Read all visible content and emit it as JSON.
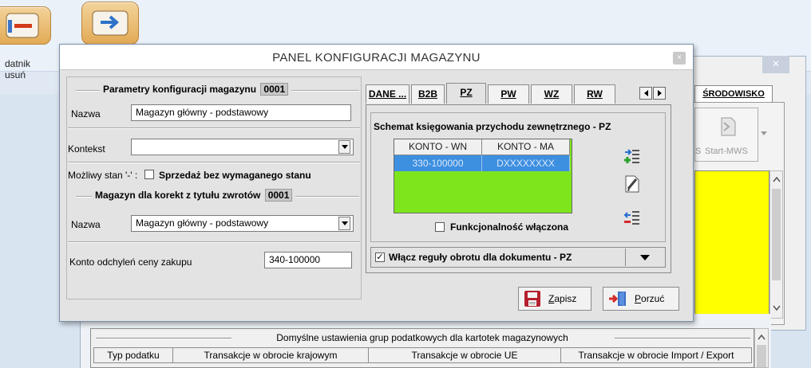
{
  "background": {
    "left_labels": [
      "datnik",
      "usuń"
    ],
    "srodowisko_tab": "ŚRODOWISKO",
    "start_mws": "Start-MWS",
    "start_prefix": "S",
    "close_glyph": "×",
    "bottom_grid": {
      "title": "Domyślne ustawienia grup podatkowych dla kartotek magazynowych",
      "columns": [
        "Typ podatku",
        "Transakcje w obrocie krajowym",
        "Transakcje w obrocie UE",
        "Transakcje w obrocie Import / Export"
      ]
    }
  },
  "dialog": {
    "title": "PANEL KONFIGURACJI MAGAZYNU",
    "close_glyph": "×",
    "params": {
      "legend": "Parametry konfiguracji magazynu",
      "code": "0001",
      "nazwa_label": "Nazwa",
      "nazwa_value": "Magazyn główny - podstawowy",
      "kontekst_label": "Kontekst",
      "kontekst_value": "",
      "mozliwy_stan_label": "Możliwy stan '-' :",
      "sprzedaz_label": "Sprzedaż bez wymaganego stanu"
    },
    "korekty": {
      "legend": "Magazyn dla korekt z tytułu zwrotów",
      "code": "0001",
      "nazwa_label": "Nazwa",
      "nazwa_value": "Magazyn główny - podstawowy"
    },
    "konto": {
      "label": "Konto odchyleń ceny zakupu",
      "value": "340-100000"
    },
    "tabs": [
      "DANE ...",
      "B2B",
      "PZ",
      "PW",
      "WZ",
      "RW"
    ],
    "active_tab": "PZ",
    "pz": {
      "schema_title": "Schemat księgowania przychodu zewnętrznego - PZ",
      "columns": [
        "KONTO - WN",
        "KONTO - MA"
      ],
      "rows": [
        [
          "330-100000",
          "DXXXXXXXX"
        ]
      ],
      "functionality_label": "Funkcjonalność włączona",
      "functionality_checked": false,
      "rules_label": "Włącz reguły obrotu dla dokumentu - PZ",
      "rules_checked": true,
      "rules_check_glyph": "✓"
    },
    "buttons": {
      "save": "Zapisz",
      "save_underline": "Z",
      "save_rest": "apisz",
      "cancel_underline": "P",
      "cancel_rest": "orzuć",
      "cancel": "Porzuć"
    }
  }
}
